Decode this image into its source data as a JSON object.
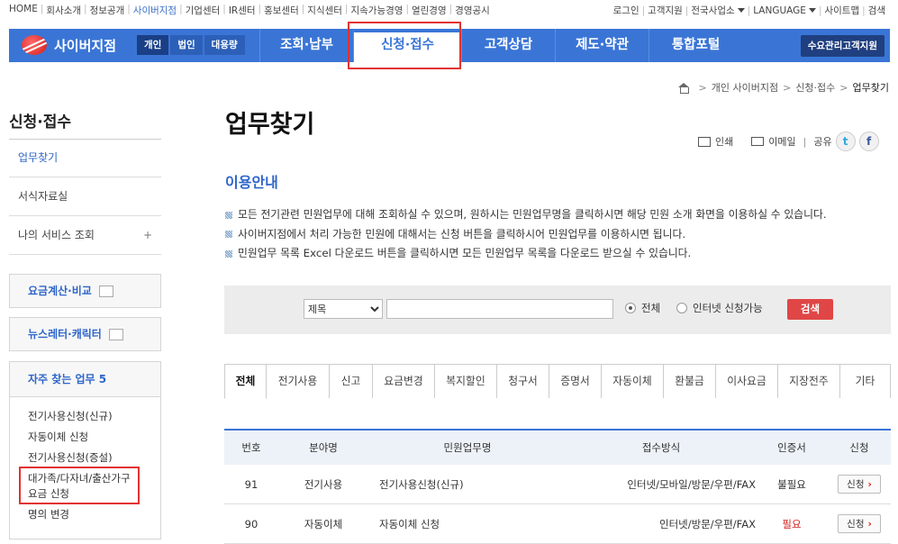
{
  "util_nav": {
    "left": [
      "HOME",
      "회사소개",
      "정보공개",
      "사이버지점",
      "기업센터",
      "IR센터",
      "홍보센터",
      "지식센터",
      "지속가능경영",
      "열린경영",
      "경영공시"
    ],
    "right": [
      "로그인",
      "고객지원",
      "전국사업소",
      "LANGUAGE",
      "사이트맵",
      "검색"
    ]
  },
  "gnb": {
    "logo": "사이버지점",
    "segments": [
      "개인",
      "법인",
      "대용량"
    ],
    "menu": [
      "조회·납부",
      "신청·접수",
      "고객상담",
      "제도·약관",
      "통합포털"
    ],
    "right_button": "수요관리고객지원"
  },
  "breadcrumb": [
    "개인 사이버지점",
    "신청·접수",
    "업무찾기"
  ],
  "sidebar": {
    "title": "신청·접수",
    "items": [
      {
        "label": "업무찾기"
      },
      {
        "label": "서식자료실"
      },
      {
        "label": "나의 서비스 조회",
        "plus": "+"
      }
    ],
    "boxes": [
      "요금계산·비교",
      "뉴스레터·캐릭터"
    ],
    "favorites": {
      "title": "자주 찾는 업무 5",
      "items": [
        "전기사용신청(신규)",
        "자동이체 신청",
        "전기사용신청(증설)",
        "대가족/다자녀/출산가구 요금 신청",
        "명의 변경"
      ]
    }
  },
  "page": {
    "title": "업무찾기",
    "tools": {
      "print": "인쇄",
      "email": "이메일",
      "share": "공유",
      "twitter": "t",
      "facebook": "f"
    },
    "subtitle": "이용안내",
    "guide": [
      "모든 전기관련 민원업무에 대해 조회하실 수 있으며, 원하시는 민원업무명을 클릭하시면 해당 민원 소개 화면을 이용하실 수 있습니다.",
      "사이버지점에서 처리 가능한 민원에 대해서는 신청 버튼을 클릭하시어 민원업무를 이용하시면 됩니다.",
      "민원업무 목록 Excel 다운로드 버튼을 클릭하시면 모든 민원업무 목록을 다운로드 받으실 수 있습니다."
    ]
  },
  "search": {
    "select_value": "제목",
    "input_value": "",
    "radio_all": "전체",
    "radio_online": "인터넷 신청가능",
    "button": "검색"
  },
  "tabs": [
    {
      "label": "전체"
    },
    {
      "label": "전기사용"
    },
    {
      "label": "신고"
    },
    {
      "label": "요금변경"
    },
    {
      "label": "복지할인"
    },
    {
      "label": "청구서"
    },
    {
      "label": "증명서"
    },
    {
      "label": "자동이체"
    },
    {
      "label": "환불금"
    },
    {
      "label": "이사요금"
    },
    {
      "label": "지장전주"
    },
    {
      "label": "기타"
    }
  ],
  "table": {
    "headers": [
      "번호",
      "분야명",
      "민원업무명",
      "접수방식",
      "인증서",
      "신청"
    ],
    "rows": [
      {
        "no": "91",
        "field": "전기사용",
        "name": "전기사용신청(신규)",
        "method": "인터넷/모바일/방문/우편/FAX",
        "cert": "불필요",
        "apply": "신청"
      },
      {
        "no": "90",
        "field": "자동이체",
        "name": "자동이체 신청",
        "method": "인터넷/방문/우편/FAX",
        "cert": "필요",
        "apply": "신청"
      }
    ]
  },
  "colors": {
    "brand_blue": "#3a75d6",
    "highlight_red": "#e23232",
    "search_red": "#e04646"
  }
}
